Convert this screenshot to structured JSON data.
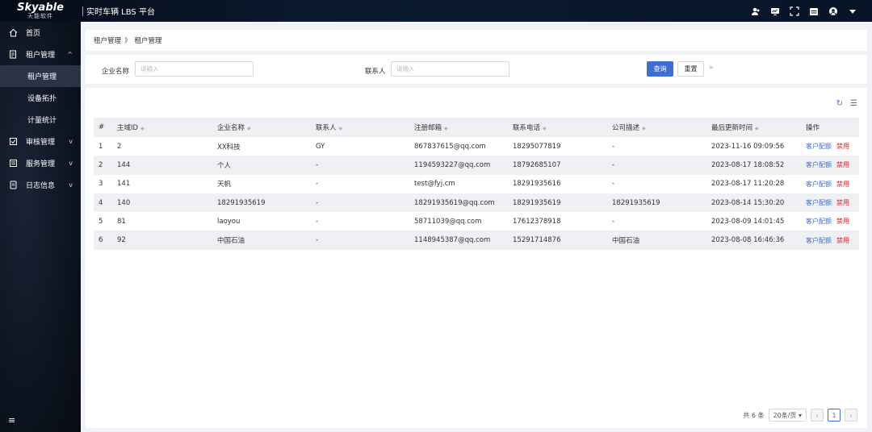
{
  "header": {
    "logo_brand": "Skyable",
    "logo_sub": "天能软件",
    "app_title": "实时车辆 LBS 平台"
  },
  "header_icons": [
    "user-group-icon",
    "monitor-icon",
    "fullscreen-icon",
    "calendar-icon",
    "avatar-icon",
    "caret-down-icon"
  ],
  "sidebar": {
    "home": "首页",
    "tenant_group": "租户管理",
    "tenant_items": [
      "租户管理",
      "设备拓扑",
      "计量统计"
    ],
    "active_item": "租户管理",
    "review": "审核管理",
    "service": "服务管理",
    "logs": "日志信息"
  },
  "breadcrumb": {
    "parent": "租户管理",
    "separator": "》",
    "current": "租户管理"
  },
  "filter": {
    "company_label": "企业名称",
    "company_placeholder": "请输入",
    "contact_label": "联系人",
    "contact_placeholder": "请输入",
    "search_label": "查询",
    "reset_label": "重置"
  },
  "table": {
    "columns": [
      "#",
      "主域ID",
      "企业名称",
      "联系人",
      "注册邮箱",
      "联系电话",
      "公司描述",
      "最后更新时间",
      "操作"
    ],
    "rows": [
      {
        "idx": "1",
        "id": "2",
        "company": "XX科技",
        "contact": "GY",
        "email": "867837615@qq.com",
        "phone": "18295077819",
        "desc": "-",
        "updated": "2023-11-16 09:09:56"
      },
      {
        "idx": "2",
        "id": "144",
        "company": "个人",
        "contact": "-",
        "email": "1194593227@qq.com",
        "phone": "18792685107",
        "desc": "-",
        "updated": "2023-08-17 18:08:52"
      },
      {
        "idx": "3",
        "id": "141",
        "company": "天帆",
        "contact": "-",
        "email": "test@fyj.cm",
        "phone": "18291935616",
        "desc": "-",
        "updated": "2023-08-17 11:20:28"
      },
      {
        "idx": "4",
        "id": "140",
        "company": "18291935619",
        "contact": "-",
        "email": "18291935619@qq.com",
        "phone": "18291935619",
        "desc": "18291935619",
        "updated": "2023-08-14 15:30:20"
      },
      {
        "idx": "5",
        "id": "81",
        "company": "laoyou",
        "contact": "-",
        "email": "58711039@qq.com",
        "phone": "17612378918",
        "desc": "-",
        "updated": "2023-08-09 14:01:45"
      },
      {
        "idx": "6",
        "id": "92",
        "company": "中国石油",
        "contact": "-",
        "email": "1148945387@qq.com",
        "phone": "15291714876",
        "desc": "中国石油",
        "updated": "2023-08-08 16:46:36"
      }
    ],
    "op_config": "客户配额",
    "op_disable": "禁用"
  },
  "pagination": {
    "total": "共 6 条",
    "page_size": "20条/页",
    "current_page": "1"
  },
  "colors": {
    "primary": "#3e6fd6",
    "danger": "#e02020",
    "sidebar_bg": "#0c1420",
    "active_item_bg": "#2b3446"
  }
}
